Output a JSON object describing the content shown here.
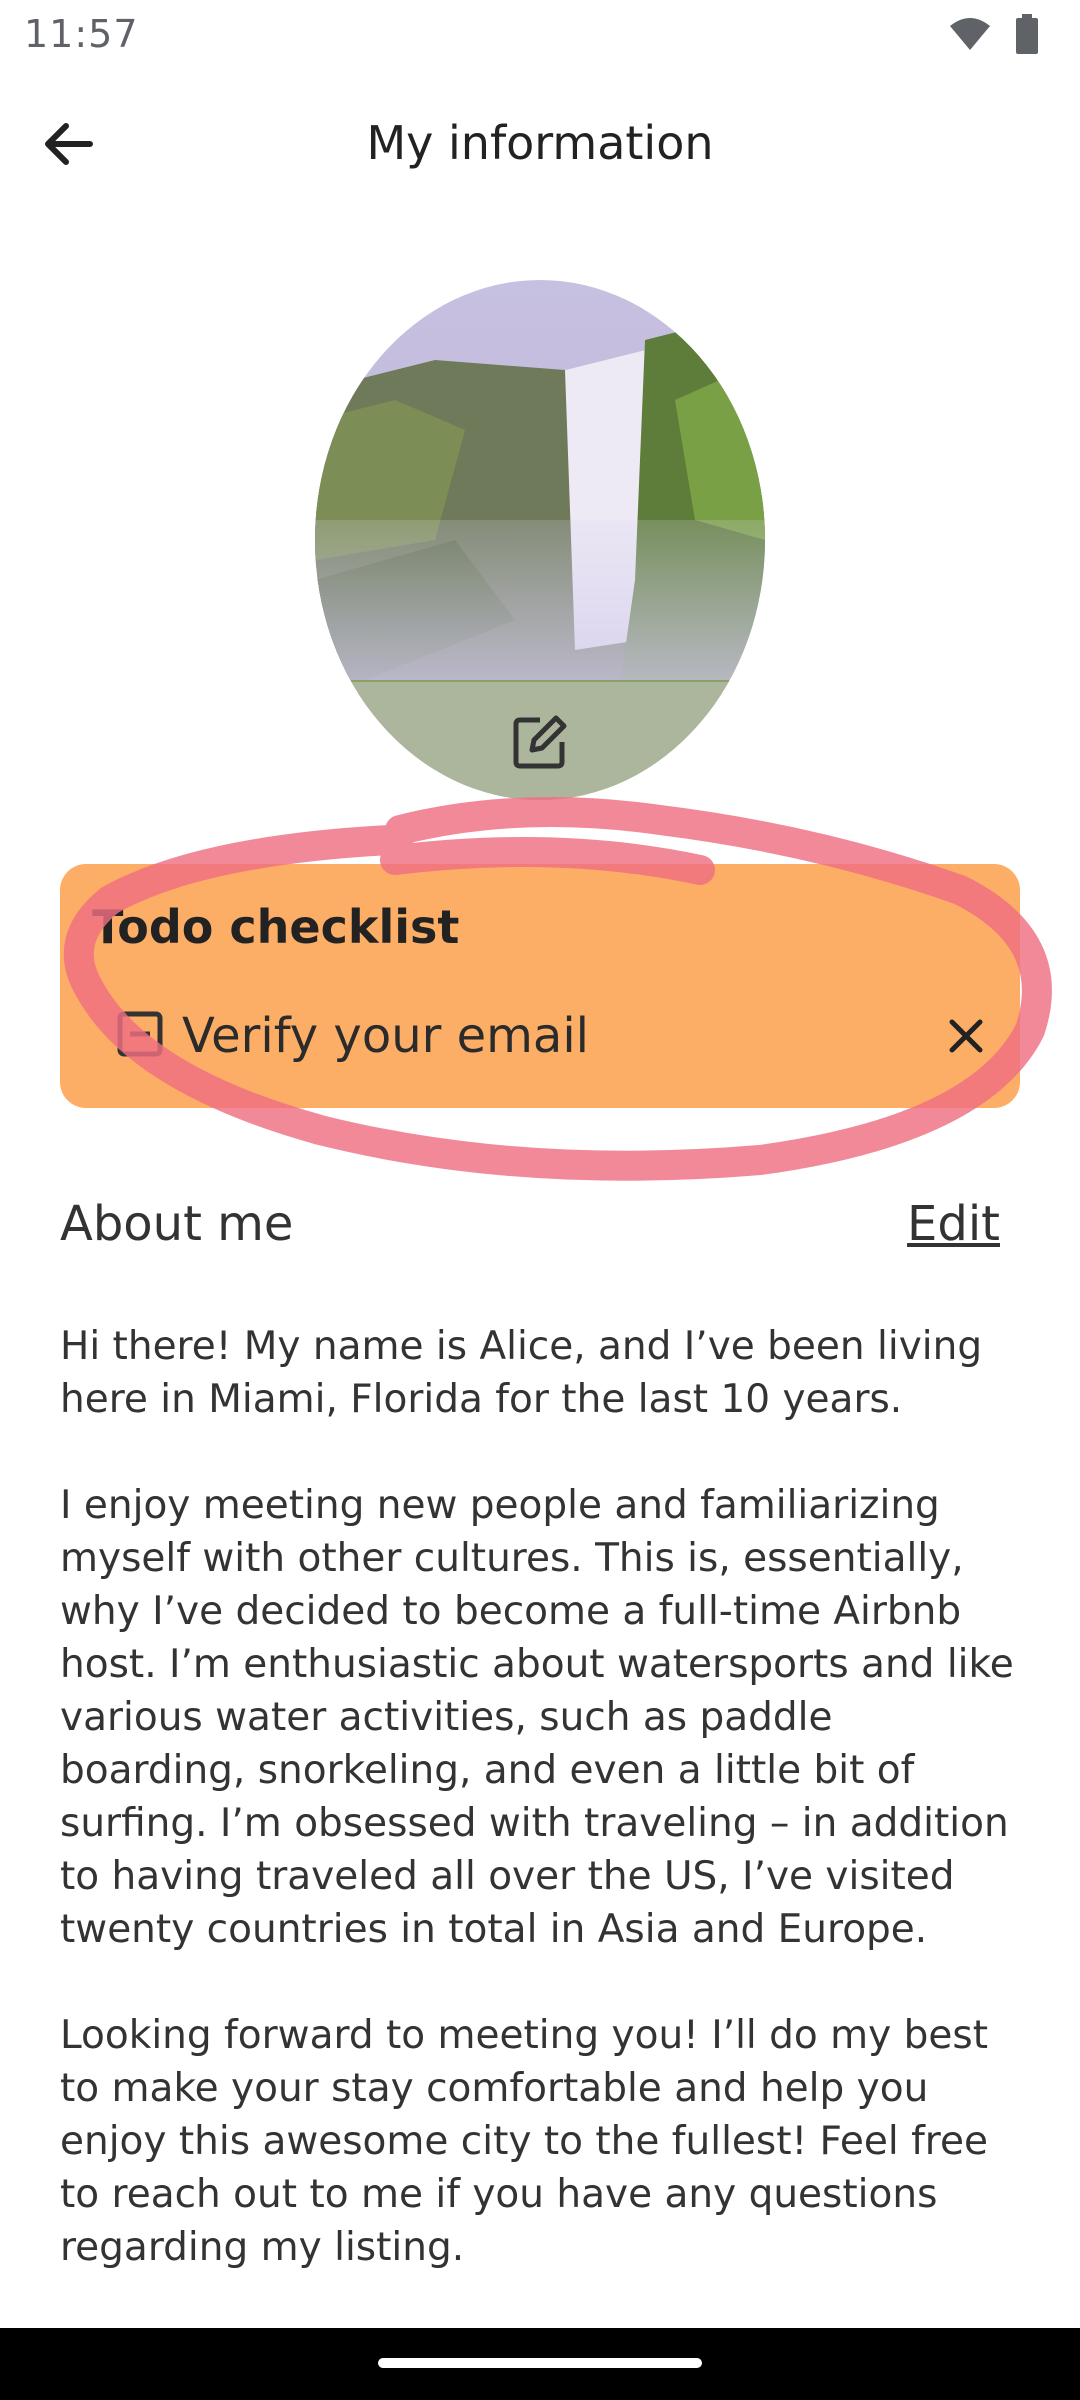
{
  "status_bar": {
    "time": "11:57",
    "icons": [
      "wifi-icon",
      "battery-icon"
    ]
  },
  "header": {
    "title": "My information",
    "back_icon": "arrow-left-icon"
  },
  "profile_photo": {
    "edit_icon": "edit-icon"
  },
  "todo_checklist": {
    "title": "Todo checklist",
    "background": "#fdae66",
    "items": [
      {
        "label": "Verify your email",
        "icon": "checkbox-indeterminate-icon",
        "dismiss_icon": "close-icon"
      }
    ]
  },
  "about": {
    "title": "About me",
    "edit_label": "Edit",
    "paragraphs": [
      "Hi there! My name is Alice, and I’ve been living here in Miami, Florida for the last 10 years.",
      "I enjoy meeting new people and familiarizing myself with other cultures. This is, essentially, why I’ve decided to become a full-time Airbnb host. I’m enthusiastic about watersports and like various water activities, such as paddle boarding, snorkeling, and even a little bit of surfing. I’m obsessed with traveling – in addition to having traveled all over the US, I’ve visited twenty countries in total in Asia and Europe.",
      "Looking forward to meeting you! I’ll do my best to make your stay comfortable and help you enjoy this awesome city to the fullest! Feel free to reach out to me if you have any questions regarding my listing."
    ]
  },
  "colors": {
    "annotation": "#ef6f82",
    "nav_bar": "#000000"
  }
}
